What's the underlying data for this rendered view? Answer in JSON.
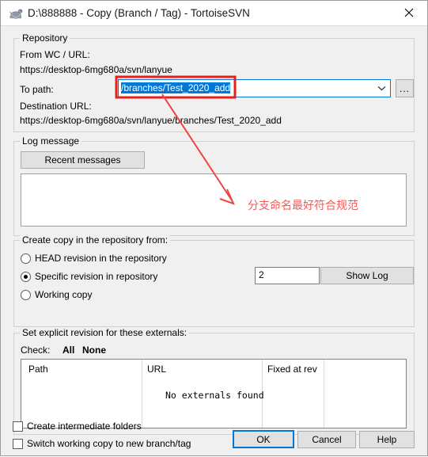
{
  "window": {
    "title": "D:\\888888 - Copy (Branch / Tag) - TortoiseSVN",
    "icon": "tortoisesvn-turtle-icon",
    "close_label": "✕"
  },
  "repository": {
    "group_title": "Repository",
    "from_label": "From WC / URL:",
    "from_url": "https://desktop-6mg680a/svn/lanyue",
    "to_path_label": "To path:",
    "to_path_value": "/branches/Test_2020_add",
    "to_path_placeholder": "",
    "browse_label": "...",
    "destination_label": "Destination URL:",
    "destination_url": "https://desktop-6mg680a/svn/lanyue/branches/Test_2020_add"
  },
  "log_message": {
    "group_title": "Log message",
    "recent_button": "Recent messages",
    "text_value": "",
    "placeholder": ""
  },
  "create_copy": {
    "group_title": "Create copy in the repository from:",
    "options": [
      {
        "label": "HEAD revision in the repository",
        "selected": false
      },
      {
        "label": "Specific revision in repository",
        "selected": true
      },
      {
        "label": "Working copy",
        "selected": false
      }
    ],
    "revision_value": "2",
    "show_log_button": "Show Log"
  },
  "externals": {
    "group_title": "Set explicit revision for these externals:",
    "check_label": "Check:",
    "check_all": "All",
    "check_none": "None",
    "columns": [
      "Path",
      "URL",
      "Fixed at rev",
      ""
    ],
    "empty_message": "No externals found",
    "rows": []
  },
  "footer": {
    "checkboxes": [
      {
        "label": "Create intermediate folders",
        "checked": false
      },
      {
        "label": "Switch working copy to new branch/tag",
        "checked": false
      }
    ],
    "ok_label": "OK",
    "cancel_label": "Cancel",
    "help_label": "Help"
  },
  "annotation": {
    "text": "分支命名最好符合规范",
    "color": "#f25a5a",
    "highlight_color": "#e8201a"
  }
}
